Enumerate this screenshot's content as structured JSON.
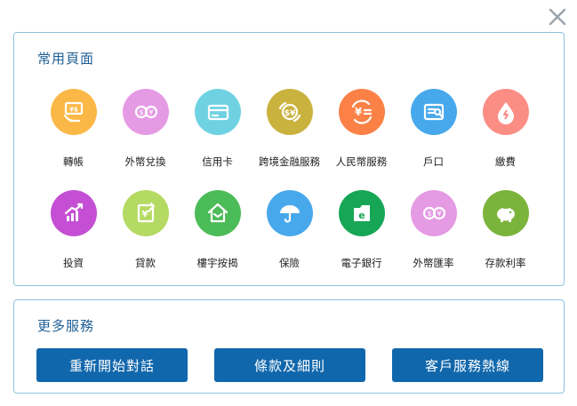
{
  "close": {
    "icon": "close-icon"
  },
  "common_pages": {
    "title": "常用頁面",
    "items": [
      {
        "label": "轉帳",
        "icon": "transfer-icon",
        "color": "#fbb846"
      },
      {
        "label": "外幣兌換",
        "icon": "currency-exchange-icon",
        "color": "#e59ae4"
      },
      {
        "label": "信用卡",
        "icon": "credit-card-icon",
        "color": "#6fd2e2"
      },
      {
        "label": "跨境金融服務",
        "icon": "cross-border-icon",
        "color": "#c9b23e"
      },
      {
        "label": "人民幣服務",
        "icon": "rmb-icon",
        "color": "#fb8147"
      },
      {
        "label": "戶口",
        "icon": "account-icon",
        "color": "#47a8ec"
      },
      {
        "label": "繳費",
        "icon": "bill-payment-icon",
        "color": "#fb8d85"
      },
      {
        "label": "投資",
        "icon": "investment-icon",
        "color": "#c44fd4"
      },
      {
        "label": "貸款",
        "icon": "loan-icon",
        "color": "#b5da63"
      },
      {
        "label": "樓宇按揭",
        "icon": "mortgage-icon",
        "color": "#4cbc58"
      },
      {
        "label": "保險",
        "icon": "insurance-icon",
        "color": "#47a8ec"
      },
      {
        "label": "電子銀行",
        "icon": "e-banking-icon",
        "color": "#17a655"
      },
      {
        "label": "外幣匯率",
        "icon": "fx-rate-icon",
        "color": "#e59ae4"
      },
      {
        "label": "存款利率",
        "icon": "deposit-rate-icon",
        "color": "#7bb43b"
      }
    ]
  },
  "more_services": {
    "title": "更多服務",
    "buttons": [
      {
        "label": "重新開始對話"
      },
      {
        "label": "條款及細則"
      },
      {
        "label": "客戶服務熱線"
      }
    ]
  }
}
